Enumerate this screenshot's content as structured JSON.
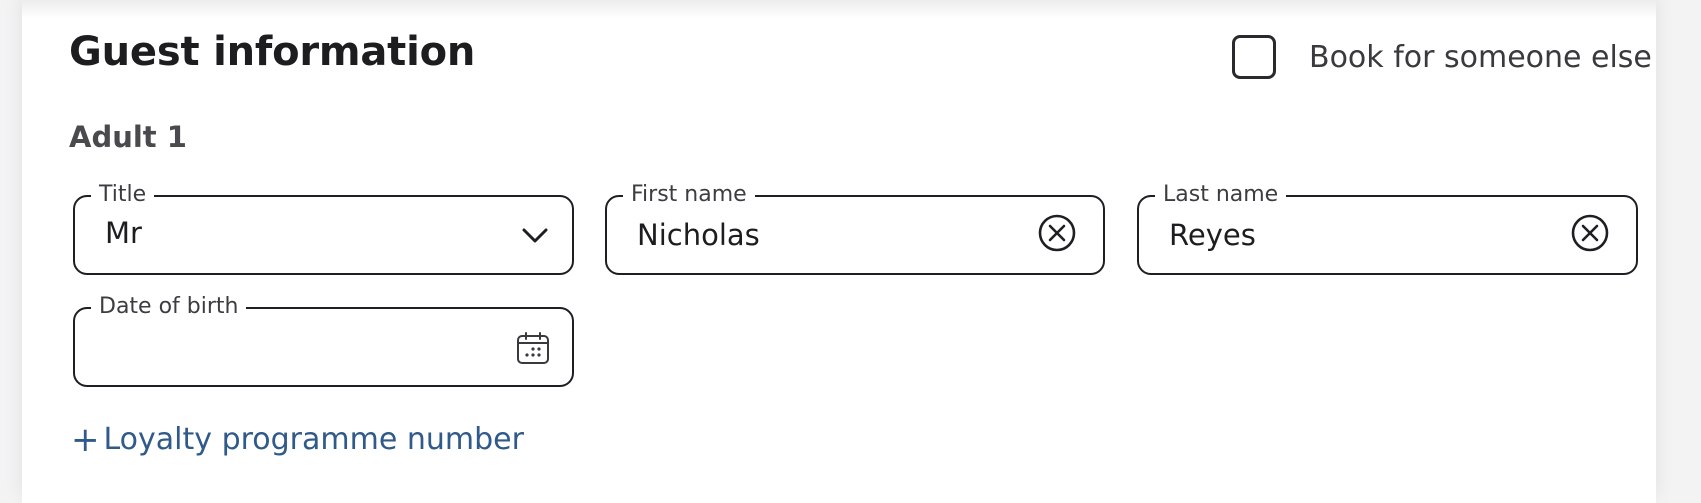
{
  "section": {
    "heading": "Guest information",
    "book_for_someone_else": {
      "label": "Book for someone else",
      "checked": false
    }
  },
  "guest": {
    "adult_label": "Adult 1",
    "title": {
      "label": "Title",
      "value": "Mr"
    },
    "first_name": {
      "label": "First name",
      "value": "Nicholas"
    },
    "last_name": {
      "label": "Last name",
      "value": "Reyes"
    },
    "date_of_birth": {
      "label": "Date of birth",
      "value": ""
    }
  },
  "loyalty": {
    "link_label": "Loyalty programme number",
    "icon": "plus-icon"
  },
  "colors": {
    "link": "#2f5a8a",
    "border": "#1f1f23",
    "text": "#1d1d1f",
    "background": "#f3f3f4"
  }
}
